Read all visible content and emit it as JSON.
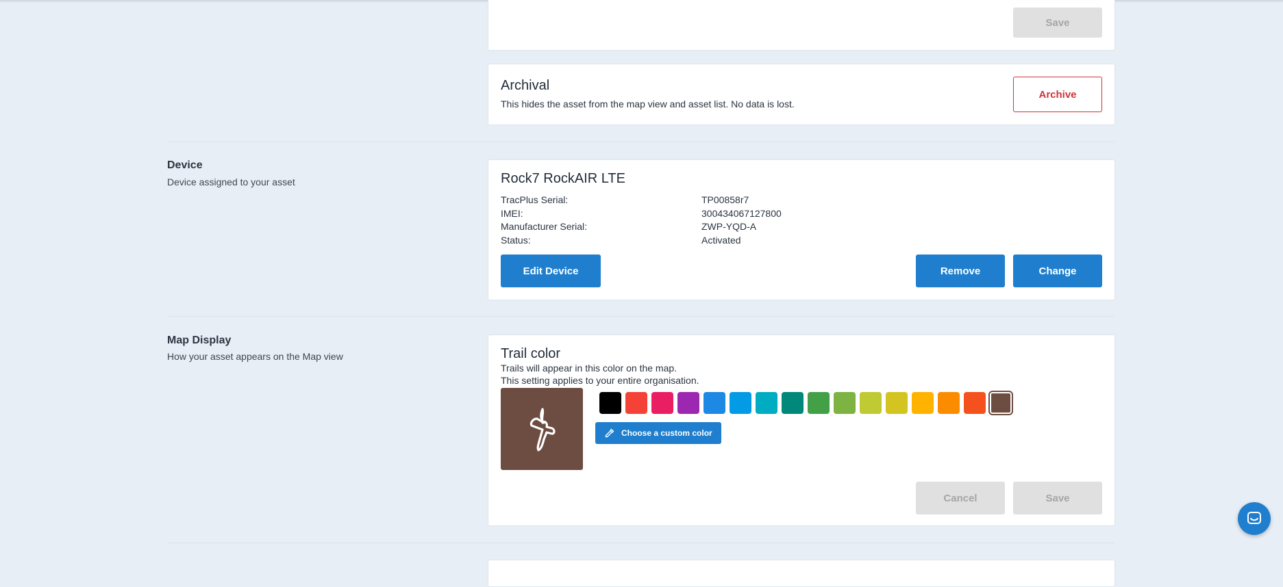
{
  "top_card": {
    "save_label": "Save"
  },
  "archival": {
    "title": "Archival",
    "description": "This hides the asset from the map view and asset list. No data is lost.",
    "archive_label": "Archive"
  },
  "device_section": {
    "title": "Device",
    "subtitle": "Device assigned to your asset",
    "device_name": "Rock7 RockAIR LTE",
    "fields": [
      {
        "label": "TracPlus Serial:",
        "value": "TP00858r7"
      },
      {
        "label": "IMEI:",
        "value": "300434067127800"
      },
      {
        "label": "Manufacturer Serial:",
        "value": "ZWP-YQD-A"
      },
      {
        "label": "Status:",
        "value": "Activated"
      }
    ],
    "edit_label": "Edit Device",
    "remove_label": "Remove",
    "change_label": "Change"
  },
  "map_display": {
    "title": "Map Display",
    "subtitle": "How your asset appears on the Map view",
    "trail_title": "Trail color",
    "trail_line1": "Trails will appear in this color on the map.",
    "trail_line2": "This setting applies to your entire organisation.",
    "preview_color": "#6d4c41",
    "custom_color_label": "Choose a custom color",
    "colors": [
      "#000000",
      "#f44336",
      "#e91e63",
      "#9c27b0",
      "#1e88e5",
      "#039be5",
      "#00acc1",
      "#00897b",
      "#43a047",
      "#7cb342",
      "#c0ca33",
      "#d4c421",
      "#ffb300",
      "#fb8c00",
      "#f4511e",
      "#6d4c41"
    ],
    "selected_color": "#6d4c41",
    "cancel_label": "Cancel",
    "save_label": "Save"
  },
  "icons": {
    "aircraft": "aircraft-icon",
    "eyedropper": "eyedropper-icon",
    "chat": "chat-icon"
  }
}
